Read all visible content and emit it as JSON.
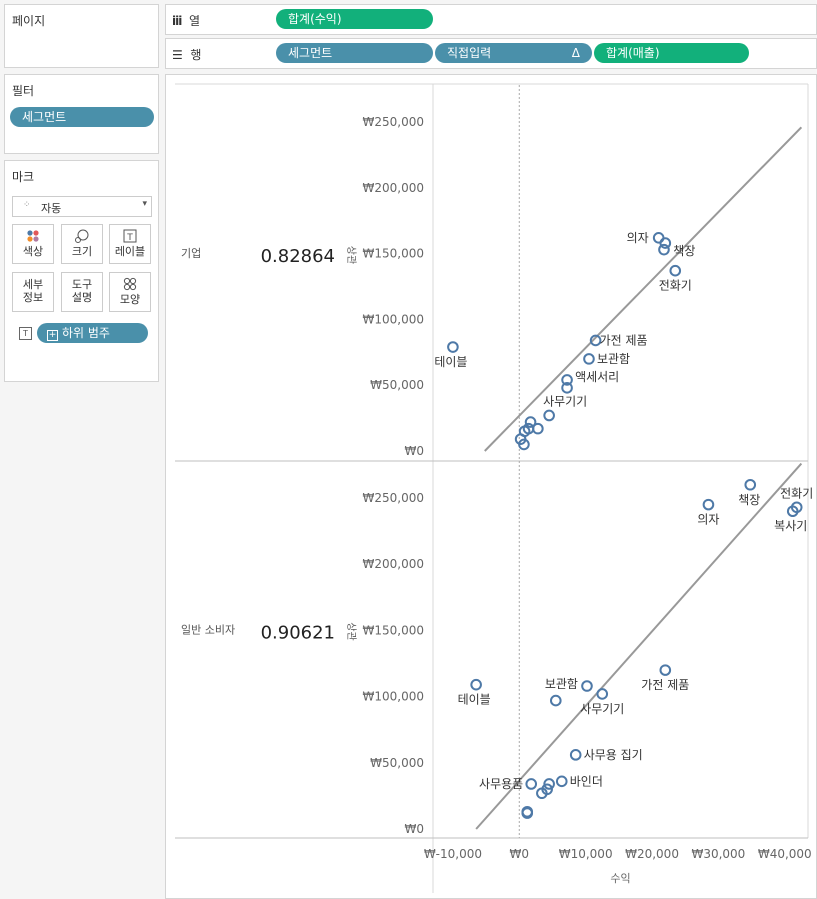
{
  "pages_card": {
    "title": "페이지"
  },
  "shelves": {
    "columns": {
      "icon": "columns-icon",
      "label": "열",
      "pills": [
        "합계(수익)"
      ]
    },
    "rows": {
      "icon": "rows-icon",
      "label": "행",
      "pills": [
        "세그먼트",
        "직접입력",
        "합계(매출)"
      ],
      "delta_symbol": "Δ"
    }
  },
  "filters_card": {
    "title": "필터",
    "pills": [
      "세그먼트"
    ]
  },
  "marks_card": {
    "title": "마크",
    "mark_type": "자동",
    "buttons": [
      {
        "label": "색상",
        "icon": "color-icon"
      },
      {
        "label": "크기",
        "icon": "size-icon"
      },
      {
        "label": "레이블",
        "icon": "label-icon"
      },
      {
        "label": "세부\n정보",
        "icon": "detail-icon"
      },
      {
        "label": "도구\n설명",
        "icon": "tooltip-icon"
      },
      {
        "label": "모양",
        "icon": "shape-icon"
      }
    ],
    "label_field": "하위 범주"
  },
  "chart_data": {
    "type": "scatter",
    "xlabel": "수익",
    "x_ticks": [
      "₩-10,000",
      "₩0",
      "₩10,000",
      "₩20,000",
      "₩30,000",
      "₩40,000"
    ],
    "x_tick_values": [
      -10000,
      0,
      10000,
      20000,
      30000,
      40000
    ],
    "xlim": [
      -13000,
      43500
    ],
    "y_ticks": [
      "₩0",
      "₩50,000",
      "₩100,000",
      "₩150,000",
      "₩200,000",
      "₩250,000"
    ],
    "y_tick_values": [
      0,
      50000,
      100000,
      150000,
      200000,
      250000
    ],
    "marker_color": "#4e79a7",
    "trend_color": "#999999",
    "panes": [
      {
        "segment": "기업",
        "r_value": "0.82864",
        "r_label": "상관",
        "ylim": [
          0,
          250000
        ],
        "trend": {
          "x": [
            -5200,
            42500
          ],
          "y": [
            0,
            246000
          ]
        },
        "points": [
          {
            "x": -10000,
            "y": 79000,
            "label": "테이블"
          },
          {
            "x": 21000,
            "y": 162000,
            "label": "의자"
          },
          {
            "x": 22000,
            "y": 158000,
            "label": "책장"
          },
          {
            "x": 21800,
            "y": 153000,
            "label": ""
          },
          {
            "x": 23500,
            "y": 137000,
            "label": "전화기"
          },
          {
            "x": 11500,
            "y": 84000,
            "label": "가전 제품"
          },
          {
            "x": 10500,
            "y": 70000,
            "label": "보관함"
          },
          {
            "x": 7200,
            "y": 54000,
            "label": "액세서리"
          },
          {
            "x": 7200,
            "y": 48000,
            "label": ""
          },
          {
            "x": 4500,
            "y": 27000,
            "label": "사무기기"
          },
          {
            "x": 1700,
            "y": 22000,
            "label": ""
          },
          {
            "x": 1400,
            "y": 17000,
            "label": ""
          },
          {
            "x": 2800,
            "y": 17000,
            "label": ""
          },
          {
            "x": 800,
            "y": 15000,
            "label": ""
          },
          {
            "x": 200,
            "y": 9000,
            "label": ""
          },
          {
            "x": 700,
            "y": 5000,
            "label": ""
          }
        ]
      },
      {
        "segment": "일반 소비자",
        "r_value": "0.90621",
        "r_label": "상관",
        "ylim": [
          0,
          265000
        ],
        "trend": {
          "x": [
            -6500,
            42500
          ],
          "y": [
            0,
            276000
          ]
        },
        "points": [
          {
            "x": -6500,
            "y": 109000,
            "label": "테이블"
          },
          {
            "x": 28500,
            "y": 245000,
            "label": "의자"
          },
          {
            "x": 34800,
            "y": 260000,
            "label": "책장"
          },
          {
            "x": 41800,
            "y": 243000,
            "label": "전화기"
          },
          {
            "x": 41200,
            "y": 240000,
            "label": "복사기"
          },
          {
            "x": 22000,
            "y": 120000,
            "label": "가전 제품"
          },
          {
            "x": 10200,
            "y": 108000,
            "label": "보관함"
          },
          {
            "x": 12500,
            "y": 102000,
            "label": "사무기기"
          },
          {
            "x": 5500,
            "y": 97000,
            "label": ""
          },
          {
            "x": 8500,
            "y": 56000,
            "label": "사무용 집기"
          },
          {
            "x": 6400,
            "y": 36000,
            "label": "바인더"
          },
          {
            "x": 1800,
            "y": 34000,
            "label": "사무용품"
          },
          {
            "x": 4500,
            "y": 34000,
            "label": ""
          },
          {
            "x": 4200,
            "y": 30000,
            "label": ""
          },
          {
            "x": 3400,
            "y": 27000,
            "label": ""
          },
          {
            "x": 1200,
            "y": 13000,
            "label": ""
          },
          {
            "x": 1200,
            "y": 12000,
            "label": ""
          }
        ]
      }
    ]
  }
}
